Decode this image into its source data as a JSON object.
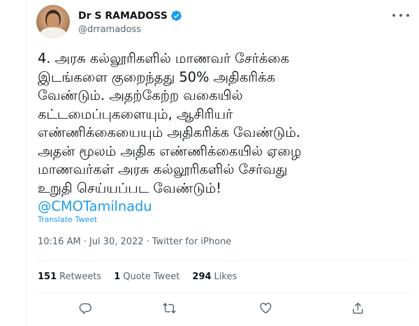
{
  "author": {
    "name": "Dr S RAMADOSS",
    "handle": "@drramadoss",
    "verified": true,
    "verified_color": "#1d9bf0"
  },
  "tweet": {
    "lines": [
      "4. அரசு கல்லூரிகளில் மாணவர் சேர்க்கை",
      "இடங்களை குறைந்தது 50% அதிகரிக்க",
      "வேண்டும். அதற்கேற்ற வகையில்",
      "கட்டமைப்புகளையும், ஆசிரியர்",
      "எண்ணிக்கையையும் அதிகரிக்க வேண்டும்.",
      "அதன் மூலம்  அதிக எண்ணிக்கையில் ஏழை",
      "மாணவர்கள் அரசு கல்லூரிகளில் சேர்வது",
      "உறுதி செய்யப்பட வேண்டும்!"
    ],
    "mention": "@CMOTamilnadu",
    "translate_label": "Translate Tweet",
    "time": "10:16 AM",
    "separator": "·",
    "date": "Jul 30, 2022",
    "source": "Twitter for iPhone"
  },
  "stats": {
    "retweets_count": "151",
    "retweets_label": "Retweets",
    "quotes_count": "1",
    "quotes_label": "Quote Tweet",
    "likes_count": "294",
    "likes_label": "Likes"
  },
  "actions": {
    "reply_icon": "reply-icon",
    "retweet_icon": "retweet-icon",
    "like_icon": "like-icon",
    "share_icon": "share-icon"
  },
  "colors": {
    "accent": "#1d9bf0",
    "text": "#0f1419",
    "muted": "#536471",
    "divider": "#eff3f4"
  }
}
